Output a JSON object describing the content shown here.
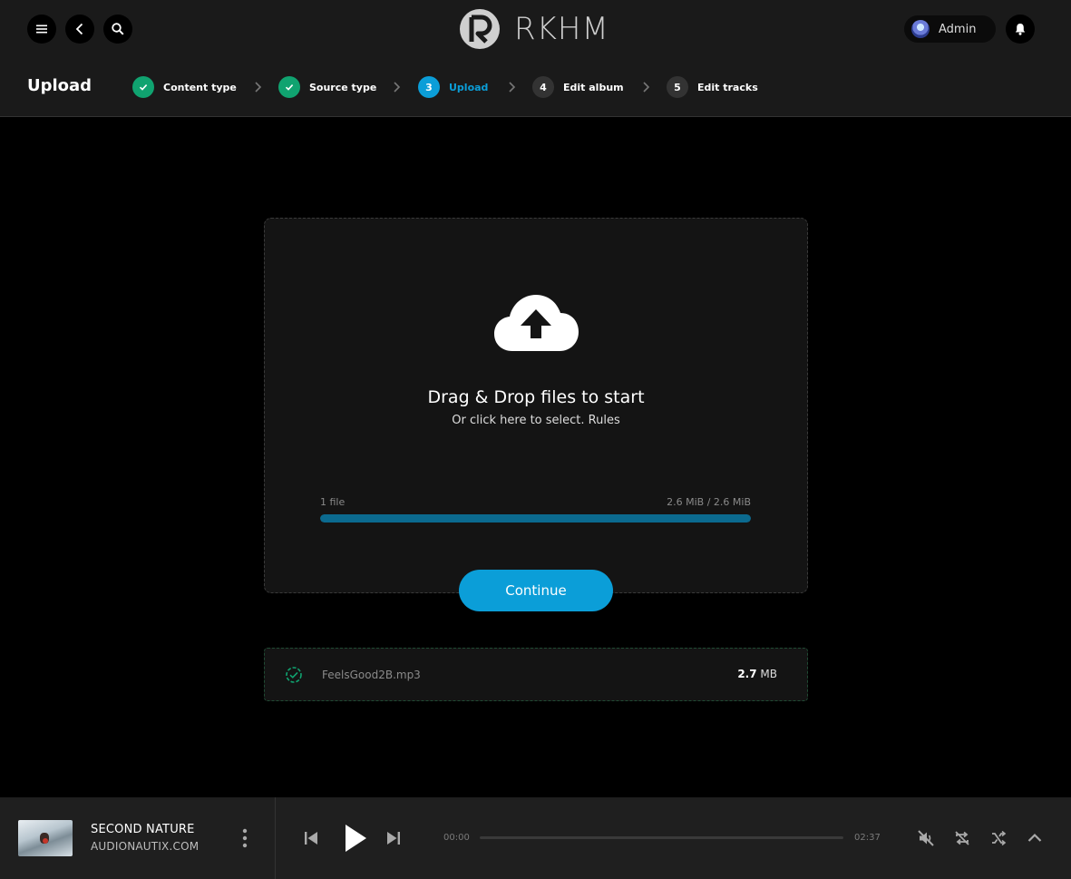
{
  "header": {
    "brand": "RKHM",
    "user_name": "Admin"
  },
  "steps_bar": {
    "page_title": "Upload",
    "steps": [
      {
        "marker": "",
        "label": "Content type",
        "state": "done"
      },
      {
        "marker": "",
        "label": "Source type",
        "state": "done"
      },
      {
        "marker": "3",
        "label": "Upload",
        "state": "active"
      },
      {
        "marker": "4",
        "label": "Edit album",
        "state": "pending"
      },
      {
        "marker": "5",
        "label": "Edit tracks",
        "state": "pending"
      }
    ]
  },
  "dropzone": {
    "title": "Drag & Drop files to start",
    "subtitle": "Or click here to select. Rules",
    "file_count": "1 file",
    "progress_text": "2.6 MiB / 2.6 MiB",
    "progress_fraction": 1.0,
    "continue_label": "Continue"
  },
  "files": [
    {
      "name": "FeelsGood2B.mp3",
      "size_value": "2.7",
      "size_unit": "MB"
    }
  ],
  "player": {
    "title": "SECOND NATURE",
    "artist": "AUDIONAUTIX.COM",
    "elapsed": "00:00",
    "duration": "02:37"
  },
  "colors": {
    "done": "#10a370",
    "active": "#0b9ed8",
    "pending": "#333333",
    "progress": "#0b6a8f"
  },
  "icons": [
    "menu-icon",
    "back-icon",
    "search-icon",
    "bell-icon",
    "cloud-upload-icon",
    "check-circle-icon",
    "kebab-icon",
    "skip-previous-icon",
    "play-icon",
    "skip-next-icon",
    "mute-icon",
    "repeat-off-icon",
    "shuffle-icon",
    "chevron-up-icon"
  ]
}
